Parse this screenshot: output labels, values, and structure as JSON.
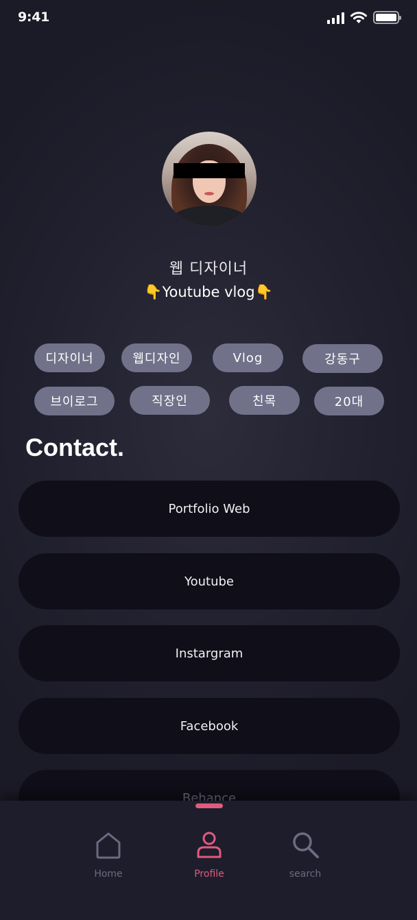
{
  "status_bar": {
    "time": "9:41"
  },
  "profile": {
    "name": "웹 디자이너",
    "bio": "👇Youtube vlog👇"
  },
  "tags": [
    "디자이너",
    "웹디자인",
    "Vlog",
    "강동구",
    "브이로그",
    "직장인",
    "친목",
    "20대"
  ],
  "contact": {
    "title": "Contact.",
    "buttons": [
      "Portfolio Web",
      "Youtube",
      "Instargram",
      "Facebook",
      "Behance"
    ]
  },
  "tab_bar": {
    "active": "Profile",
    "tabs": [
      {
        "label": "Home",
        "icon": "home-icon"
      },
      {
        "label": "Profile",
        "icon": "profile-icon"
      },
      {
        "label": "search",
        "icon": "search-icon"
      }
    ]
  },
  "colors": {
    "background": "#22212f",
    "tag": "#71718a",
    "button": "#0f0e19",
    "accent": "#e05c7d"
  }
}
